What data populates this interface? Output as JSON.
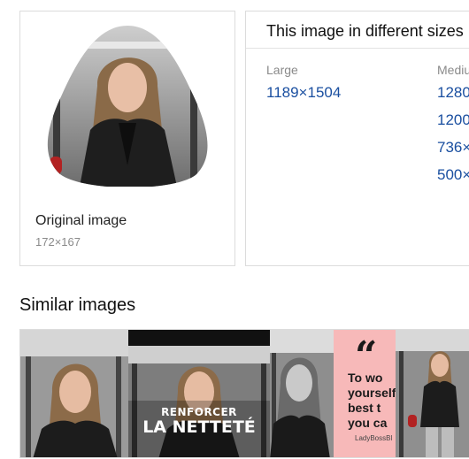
{
  "original": {
    "label": "Original image",
    "dims": "172×167"
  },
  "sizes": {
    "title": "This image in different sizes",
    "large_header": "Large",
    "medium_header": "Mediu",
    "large": [
      "1189×1504"
    ],
    "medium": [
      "1280",
      "1200",
      "736×",
      "500×"
    ]
  },
  "similar": {
    "title": "Similar images",
    "tile2_text_line1": "RENFORCER",
    "tile2_text_line2": "LA NETTETÉ",
    "tile4_quote": "“",
    "tile4_lines": [
      "To wo",
      "yourself",
      "best t",
      "you ca"
    ],
    "tile4_credit": "LadyBossBl"
  },
  "colors": {
    "link": "#1a4fa0",
    "muted": "#8a8a8a",
    "border": "#dcdcdc",
    "pink": "#f7b9b9"
  },
  "icons": {
    "quote": "quote-icon"
  }
}
